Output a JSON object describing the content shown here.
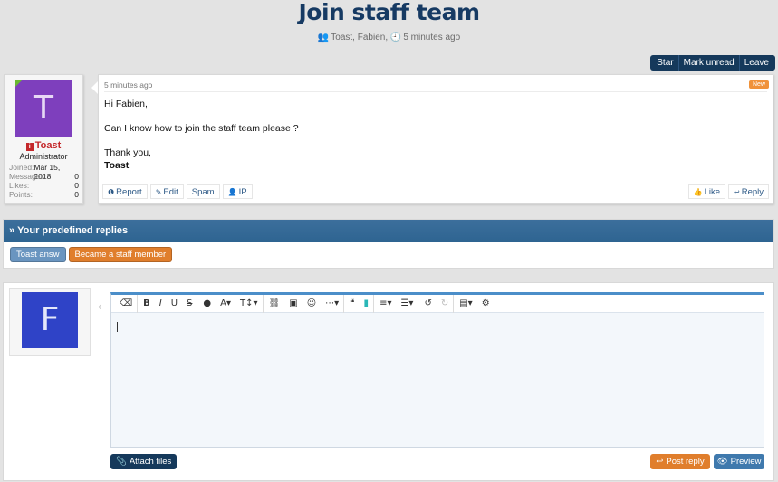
{
  "thread": {
    "title": "Join staff team",
    "participants": "Toast, Fabien",
    "time_ago": "5 minutes ago",
    "actions": [
      "Star",
      "Mark unread",
      "Leave"
    ]
  },
  "post": {
    "author": {
      "avatar_letter": "T",
      "avatar_color": "#7e3fbd",
      "name": "Toast",
      "title": "Administrator",
      "stats": [
        {
          "label": "Joined:",
          "value": "Mar 15, 2018"
        },
        {
          "label": "Messages:",
          "value": "0"
        },
        {
          "label": "Likes:",
          "value": "0"
        },
        {
          "label": "Points:",
          "value": "0"
        }
      ]
    },
    "date": "5 minutes ago",
    "new_badge": "New",
    "body": {
      "greeting": "Hi Fabien,",
      "line": "Can I know how to join the staff team please ?",
      "closing": "Thank you,",
      "signature": "Toast"
    },
    "actions_left": [
      "Report",
      "Edit",
      "Spam",
      "IP"
    ],
    "actions_right": [
      "Like",
      "Reply"
    ]
  },
  "predefined_replies": {
    "heading": "Your predefined replies",
    "buttons": [
      "Toast answ",
      "Became a staff member"
    ]
  },
  "reply": {
    "avatar_letter": "F",
    "avatar_color": "#2f43c7",
    "toolbar_icons": [
      "eraser-icon",
      "bold-icon",
      "italic-icon",
      "underline-icon",
      "strikethrough-icon",
      "color-icon",
      "font-size-icon",
      "text-style-icon",
      "link-icon",
      "image-icon",
      "smiley-icon",
      "more-icon",
      "quote-icon",
      "code-icon",
      "align-icon",
      "list-icon",
      "undo-icon",
      "redo-icon",
      "save-draft-icon",
      "settings-icon"
    ],
    "attach_label": "Attach files",
    "post_label": "Post reply",
    "preview_label": "Preview"
  }
}
